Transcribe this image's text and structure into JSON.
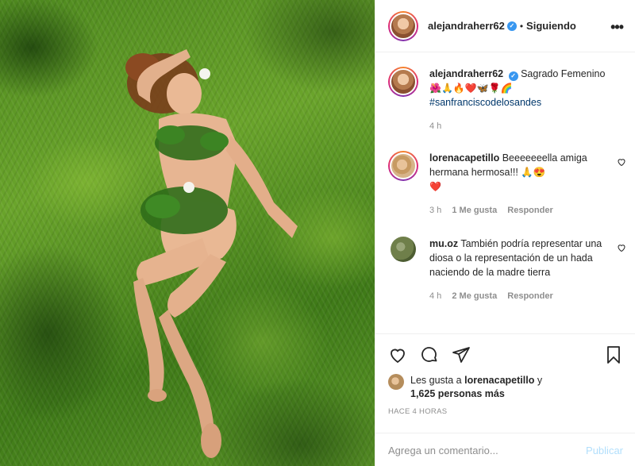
{
  "post": {
    "author": "alejandraherr62",
    "dot": "•",
    "follow_label": "Siguiendo",
    "more_label": "•••",
    "caption": {
      "username": "alejandraherr62",
      "text": "Sagrado Femenino",
      "emoji_line": "🌺🙏🔥❤️🦋🌹🌈",
      "hashtag": "#sanfranciscodelosandes",
      "time": "4 h"
    }
  },
  "comments": [
    {
      "username": "lorenacapetillo",
      "text": "Beeeeeeella amiga hermana hermosa!!! 🙏😍",
      "extra": "❤️",
      "time": "3 h",
      "likes": "1 Me gusta",
      "reply": "Responder"
    },
    {
      "username": "mu.oz",
      "text": "También podría representar una diosa o la representación de un hada naciendo de la madre tierra",
      "time": "4 h",
      "likes": "2 Me gusta",
      "reply": "Responder"
    }
  ],
  "likes": {
    "prefix": "Les gusta a",
    "user": "lorenacapetillo",
    "connector": "y",
    "count": "1,625 personas más"
  },
  "timestamp": "HACE 4 HORAS",
  "add_comment": {
    "placeholder": "Agrega un comentario...",
    "publish_label": "Publicar"
  },
  "icons": {
    "verified": "verified-badge",
    "like": "heart-icon",
    "comment": "comment-icon",
    "share": "share-icon",
    "save": "bookmark-icon",
    "options": "more-options-icon",
    "comment_like": "small-heart-icon"
  },
  "colors": {
    "verified": "#3897f0",
    "link": "#00376b",
    "muted": "#8e8e8e",
    "publish_disabled": "#b2dffc"
  }
}
